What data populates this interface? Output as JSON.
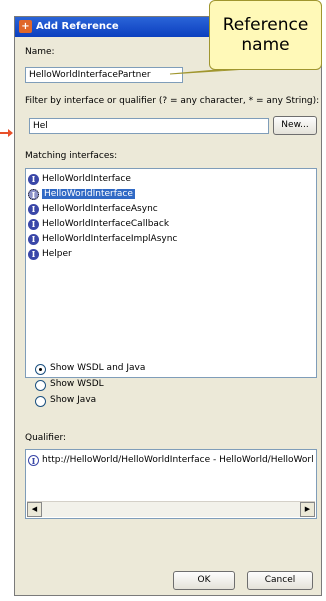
{
  "dialog": {
    "title": "Add Reference",
    "name_label": "Name:",
    "name_value": "HelloWorldInterfacePartner",
    "filter_label": "Filter by interface or qualifier (? = any character, * = any String):",
    "filter_value": "Hel",
    "new_button": "New...",
    "matching_label": "Matching interfaces:",
    "interfaces": [
      {
        "label": "HelloWorldInterface",
        "selected": false
      },
      {
        "label": "HelloWorldInterface",
        "selected": true
      },
      {
        "label": "HelloWorldInterfaceAsync",
        "selected": false
      },
      {
        "label": "HelloWorldInterfaceCallback",
        "selected": false
      },
      {
        "label": "HelloWorldInterfaceImplAsync",
        "selected": false
      },
      {
        "label": "Helper",
        "selected": false
      }
    ],
    "radio_options": [
      {
        "label": "Show WSDL and Java",
        "checked": true
      },
      {
        "label": "Show WSDL",
        "checked": false
      },
      {
        "label": "Show Java",
        "checked": false
      }
    ],
    "qualifier_label": "Qualifier:",
    "qualifier_value": "http://HelloWorld/HelloWorldInterface - HelloWorld/HelloWorl",
    "ok_button": "OK",
    "cancel_button": "Cancel"
  },
  "callout": {
    "line1": "Reference",
    "line2": "name"
  },
  "colors": {
    "accent": "#316ac5",
    "titlebar": "#0c3fbf",
    "callout_fill": "#fff9b8",
    "arrow": "#e8502a"
  },
  "icons": {
    "interface": "interface-icon",
    "app": "add-reference-icon"
  }
}
